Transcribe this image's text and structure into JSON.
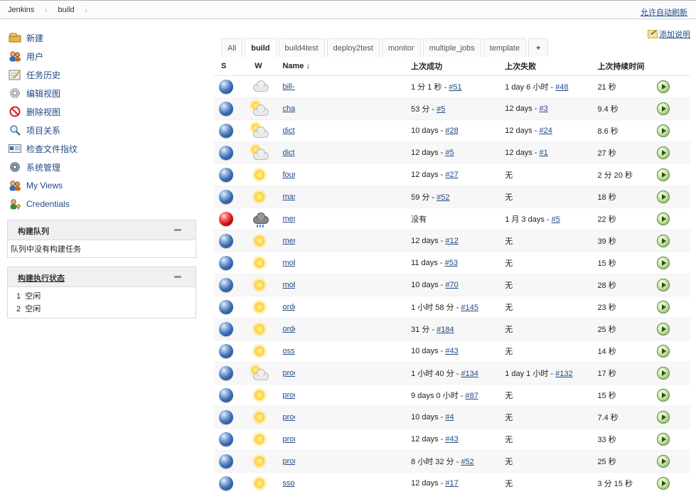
{
  "breadcrumb": {
    "root": "Jenkins",
    "view": "build",
    "sep": "›"
  },
  "header": {
    "auto_refresh": "允许自动刷新"
  },
  "sidebar": {
    "items": [
      {
        "label": "新建",
        "icon": "new-item-icon"
      },
      {
        "label": "用户",
        "icon": "people-icon"
      },
      {
        "label": "任务历史",
        "icon": "notepad-icon"
      },
      {
        "label": "编辑视图",
        "icon": "gear-icon"
      },
      {
        "label": "删除视图",
        "icon": "no-entry-icon"
      },
      {
        "label": "项目关系",
        "icon": "search-icon"
      },
      {
        "label": "检查文件指纹",
        "icon": "fingerprint-icon"
      },
      {
        "label": "系统管理",
        "icon": "settings-icon"
      },
      {
        "label": "My Views",
        "icon": "user-icon"
      },
      {
        "label": "Credentials",
        "icon": "credentials-icon"
      }
    ]
  },
  "queue": {
    "title": "构建队列",
    "empty": "队列中没有构建任务"
  },
  "executors": {
    "title": "构建执行状态",
    "rows": [
      {
        "num": "1",
        "state": "空闲"
      },
      {
        "num": "2",
        "state": "空闲"
      }
    ]
  },
  "main": {
    "add_description": "添加说明",
    "tabs": [
      "All",
      "build",
      "build4test",
      "deploy2test",
      "monitor",
      "multiple_jobs",
      "template",
      "+"
    ],
    "columns": {
      "s": "S",
      "w": "W",
      "name": "Name ↓",
      "last_success": "上次成功",
      "last_failure": "上次失败",
      "last_duration": "上次持续时间"
    }
  },
  "jobs": [
    {
      "status": "blue",
      "weather": "cloudy",
      "name": "bill-a",
      "ok": "1 分 1 秒 - ",
      "ok_link": "#51",
      "fail": "1 day 6 小时 - ",
      "fail_link": "#48",
      "dur": "21 秒"
    },
    {
      "status": "blue",
      "weather": "partly-cloudy",
      "name": "cha",
      "ok": "53 分 - ",
      "ok_link": "#5",
      "fail": "12 days - ",
      "fail_link": "#3",
      "dur": "9.4 秒"
    },
    {
      "status": "blue",
      "weather": "partly-cloudy",
      "name": "dict",
      "ok": "10 days - ",
      "ok_link": "#28",
      "fail": "12 days - ",
      "fail_link": "#24",
      "dur": "8.6 秒"
    },
    {
      "status": "blue",
      "weather": "partly-cloudy",
      "name": "dict",
      "ok": "12 days - ",
      "ok_link": "#5",
      "fail": "12 days - ",
      "fail_link": "#1",
      "dur": "27 秒"
    },
    {
      "status": "blue",
      "weather": "sunny",
      "name": "four",
      "ok": "12 days - ",
      "ok_link": "#27",
      "fail": "无",
      "fail_link": "",
      "dur": "2 分 20 秒"
    },
    {
      "status": "blue",
      "weather": "sunny",
      "name": "mas",
      "ok": "59 分 - ",
      "ok_link": "#52",
      "fail": "无",
      "fail_link": "",
      "dur": "18 秒"
    },
    {
      "status": "red",
      "weather": "stormy",
      "name": "mer",
      "ok": "没有",
      "ok_link": "",
      "fail": "1 月 3 days - ",
      "fail_link": "#5",
      "dur": "22 秒"
    },
    {
      "status": "blue",
      "weather": "sunny",
      "name": "mer",
      "ok": "12 days - ",
      "ok_link": "#12",
      "fail": "无",
      "fail_link": "",
      "dur": "39 秒"
    },
    {
      "status": "blue",
      "weather": "sunny",
      "name": "mob",
      "ok": "11 days - ",
      "ok_link": "#53",
      "fail": "无",
      "fail_link": "",
      "dur": "15 秒"
    },
    {
      "status": "blue",
      "weather": "sunny",
      "name": "mob",
      "ok": "10 days - ",
      "ok_link": "#70",
      "fail": "无",
      "fail_link": "",
      "dur": "28 秒"
    },
    {
      "status": "blue",
      "weather": "sunny",
      "name": "orde",
      "ok": "1 小时 58 分 - ",
      "ok_link": "#145",
      "fail": "无",
      "fail_link": "",
      "dur": "23 秒"
    },
    {
      "status": "blue",
      "weather": "sunny",
      "name": "orde",
      "ok": "31 分 - ",
      "ok_link": "#184",
      "fail": "无",
      "fail_link": "",
      "dur": "25 秒"
    },
    {
      "status": "blue",
      "weather": "sunny",
      "name": "oss",
      "ok": "10 days - ",
      "ok_link": "#43",
      "fail": "无",
      "fail_link": "",
      "dur": "14 秒"
    },
    {
      "status": "blue",
      "weather": "partly-cloudy",
      "name": "proc",
      "ok": "1 小时 40 分 - ",
      "ok_link": "#134",
      "fail": "1 day 1 小时 - ",
      "fail_link": "#132",
      "dur": "17 秒"
    },
    {
      "status": "blue",
      "weather": "sunny",
      "name": "proc",
      "ok": "9 days 0 小时 - ",
      "ok_link": "#87",
      "fail": "无",
      "fail_link": "",
      "dur": "15 秒"
    },
    {
      "status": "blue",
      "weather": "sunny",
      "name": "proc",
      "ok": "10 days - ",
      "ok_link": "#4",
      "fail": "无",
      "fail_link": "",
      "dur": "7.4 秒"
    },
    {
      "status": "blue",
      "weather": "sunny",
      "name": "pror",
      "ok": "12 days - ",
      "ok_link": "#43",
      "fail": "无",
      "fail_link": "",
      "dur": "33 秒"
    },
    {
      "status": "blue",
      "weather": "sunny",
      "name": "pror",
      "ok": "8 小时 32 分 - ",
      "ok_link": "#52",
      "fail": "无",
      "fail_link": "",
      "dur": "25 秒"
    },
    {
      "status": "blue",
      "weather": "sunny",
      "name": "sso",
      "ok": "12 days - ",
      "ok_link": "#17",
      "fail": "无",
      "fail_link": "",
      "dur": "3 分 15 秒"
    }
  ]
}
